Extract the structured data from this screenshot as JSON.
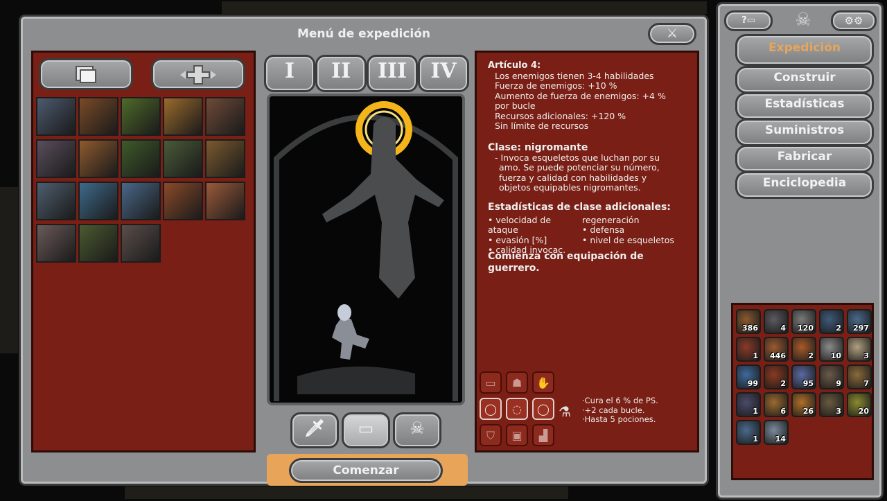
{
  "dialog": {
    "title": "Menú de expedición",
    "close_icon": "crossed-swords-icon",
    "start_label": "Comenzar"
  },
  "left_panel": {
    "deck_icon": "card-deck-icon",
    "gear_icon": "ornate-cross-icon",
    "tiles": [
      {
        "icon": "vampire-mansion-card",
        "color": "#4c5a6e"
      },
      {
        "icon": "village-card",
        "color": "#7a4a28"
      },
      {
        "icon": "grove-card",
        "color": "#4e6a2a"
      },
      {
        "icon": "wheat-fields-card",
        "color": "#9a6a2c"
      },
      {
        "icon": "cemetery-card",
        "color": "#6e4a38"
      },
      {
        "icon": "lighthouse-card",
        "color": "#5a4e5c"
      },
      {
        "icon": "smith-forge-card",
        "color": "#8e5a2e"
      },
      {
        "icon": "thicket-card",
        "color": "#3e5a2a"
      },
      {
        "icon": "forest-card",
        "color": "#4a5a38"
      },
      {
        "icon": "blood-grove-card",
        "color": "#7a5a30"
      },
      {
        "icon": "storm-temple-card",
        "color": "#4e5e6e"
      },
      {
        "icon": "river-card",
        "color": "#3e6a8a"
      },
      {
        "icon": "beacon-card",
        "color": "#4a6888"
      },
      {
        "icon": "mountain-card",
        "color": "#8a4a2a"
      },
      {
        "icon": "rock-card",
        "color": "#9a5a3a"
      },
      {
        "icon": "ancestral-crypt-card",
        "color": "#6a5a58"
      },
      {
        "icon": "swamp-card",
        "color": "#4a5a30"
      },
      {
        "icon": "arsenal-card",
        "color": "#5a4e4a"
      }
    ]
  },
  "chapters": [
    "I",
    "II",
    "III",
    "IV"
  ],
  "class_buttons": [
    {
      "icon": "sword-icon",
      "label": "warrior"
    },
    {
      "icon": "scroll-icon",
      "label": "rogue"
    },
    {
      "icon": "skull-icon",
      "label": "necromancer"
    }
  ],
  "info": {
    "chapter_title": "Artículo 4:",
    "chapter_lines": [
      "Los enemigos tienen 3-4 habilidades",
      "Fuerza de enemigos: +10 %",
      "Aumento de fuerza de enemigos: +4 %",
      "por bucle",
      "Recursos adicionales: +120 %",
      "Sin límite de recursos"
    ],
    "class_title": "Clase: nigromante",
    "class_desc": [
      "- Invoca esqueletos que luchan por su",
      "amo. Se puede potenciar su número,",
      "fuerza y calidad con habilidades y",
      "objetos equipables nigromantes."
    ],
    "stats_title": "Estadísticas de clase adicionales:",
    "stats_left": [
      "• velocidad de ataque",
      "• evasión [%]",
      "• calidad invocac."
    ],
    "stats_right": [
      "regeneración",
      "• defensa",
      "• nivel de esqueletos"
    ],
    "start_equipment": "Comienza con equipación de",
    "start_equipment_2": "guerrero.",
    "potion_lines": [
      "·Cura el 6 % de PS.",
      "·+2 cada bucle.",
      "·Hasta 5 pociones."
    ]
  },
  "equipment_slots": [
    "scroll-slot-icon",
    "helmet-slot-icon",
    "gauntlet-slot-icon",
    "ring-slot-icon",
    "amulet-slot-icon",
    "ring-slot-icon",
    "shield-slot-icon",
    "armor-slot-icon",
    "boots-slot-icon"
  ],
  "sidebar": {
    "help_icon": "help-icon",
    "settings_icon": "gear-icon",
    "emblem_icon": "skull-emblem-icon",
    "menu": [
      {
        "label": "Expedición",
        "active": true
      },
      {
        "label": "Construir",
        "active": false
      },
      {
        "label": "Estadísticas",
        "active": false
      },
      {
        "label": "Suministros",
        "active": false
      },
      {
        "label": "Fabricar",
        "active": false
      },
      {
        "label": "Enciclopedia",
        "active": false
      }
    ],
    "resources": [
      {
        "icon": "wood-resource-icon",
        "count": "386",
        "color": "#8a5a30"
      },
      {
        "icon": "metal-resource-icon",
        "count": "4",
        "color": "#5a5a60"
      },
      {
        "icon": "stone-resource-icon",
        "count": "120",
        "color": "#7a7a7a"
      },
      {
        "icon": "crystal-resource-icon",
        "count": "2",
        "color": "#3e5a7a"
      },
      {
        "icon": "orb-resource-icon",
        "count": "297",
        "color": "#4a6a8a"
      },
      {
        "icon": "flesh-resource-icon",
        "count": "1",
        "color": "#8a3a2a"
      },
      {
        "icon": "food-resource-icon",
        "count": "446",
        "color": "#9a5a30"
      },
      {
        "icon": "amber-resource-icon",
        "count": "2",
        "color": "#a85a2a"
      },
      {
        "icon": "skull-resource-icon",
        "count": "10",
        "color": "#8a8a8a"
      },
      {
        "icon": "bandage-resource-icon",
        "count": "3",
        "color": "#b0a080"
      },
      {
        "icon": "crate-resource-icon",
        "count": "99",
        "color": "#3e6a9a"
      },
      {
        "icon": "potion-resource-icon",
        "count": "2",
        "color": "#8a3a20"
      },
      {
        "icon": "afterimage-resource-icon",
        "count": "95",
        "color": "#5a6aa0"
      },
      {
        "icon": "shard-resource-icon",
        "count": "9",
        "color": "#6a5a4a"
      },
      {
        "icon": "ration-resource-icon",
        "count": "7",
        "color": "#8a6a3a"
      },
      {
        "icon": "metamorph-resource-icon",
        "count": "1",
        "color": "#4a4a6a"
      },
      {
        "icon": "scrap-resource-icon",
        "count": "6",
        "color": "#9a6a30"
      },
      {
        "icon": "gold-orb-resource-icon",
        "count": "26",
        "color": "#b0702a"
      },
      {
        "icon": "pebbles-resource-icon",
        "count": "3",
        "color": "#6a5a40"
      },
      {
        "icon": "seed-resource-icon",
        "count": "20",
        "color": "#8a8a30"
      },
      {
        "icon": "ghost-resource-icon",
        "count": "1",
        "color": "#4a6a8a"
      },
      {
        "icon": "frost-resource-icon",
        "count": "14",
        "color": "#7a8a9a"
      }
    ]
  }
}
